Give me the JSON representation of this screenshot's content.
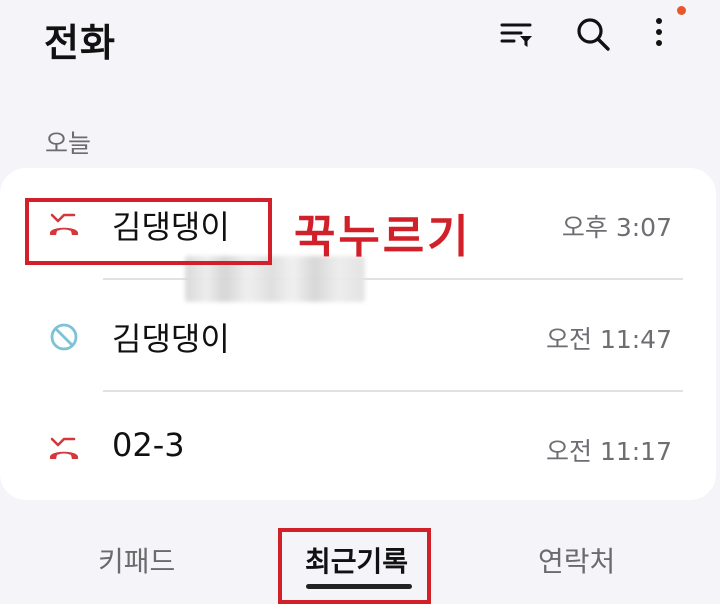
{
  "header": {
    "title": "전화",
    "actions": [
      {
        "icon": "filter-icon"
      },
      {
        "icon": "search-icon"
      },
      {
        "icon": "more-options-icon"
      }
    ]
  },
  "colors": {
    "notification_dot": "#e8572b",
    "missed_call": "#d3393a",
    "blocked_call": "#7cc3d4",
    "annotation": "#d1202a"
  },
  "section_label": "오늘",
  "calls": [
    {
      "name": "김댕댕이",
      "time": "오후 3:07",
      "icon": "missed-call-icon"
    },
    {
      "name": "김댕댕이",
      "time": "오전 11:47",
      "icon": "blocked-call-icon"
    },
    {
      "name": "02-3",
      "time": "오전 11:17",
      "icon": "missed-call-icon"
    }
  ],
  "annotation": {
    "text": "꾹누르기"
  },
  "tabs": [
    {
      "label": "키패드",
      "selected": false
    },
    {
      "label": "최근기록",
      "selected": true
    },
    {
      "label": "연락처",
      "selected": false
    }
  ]
}
